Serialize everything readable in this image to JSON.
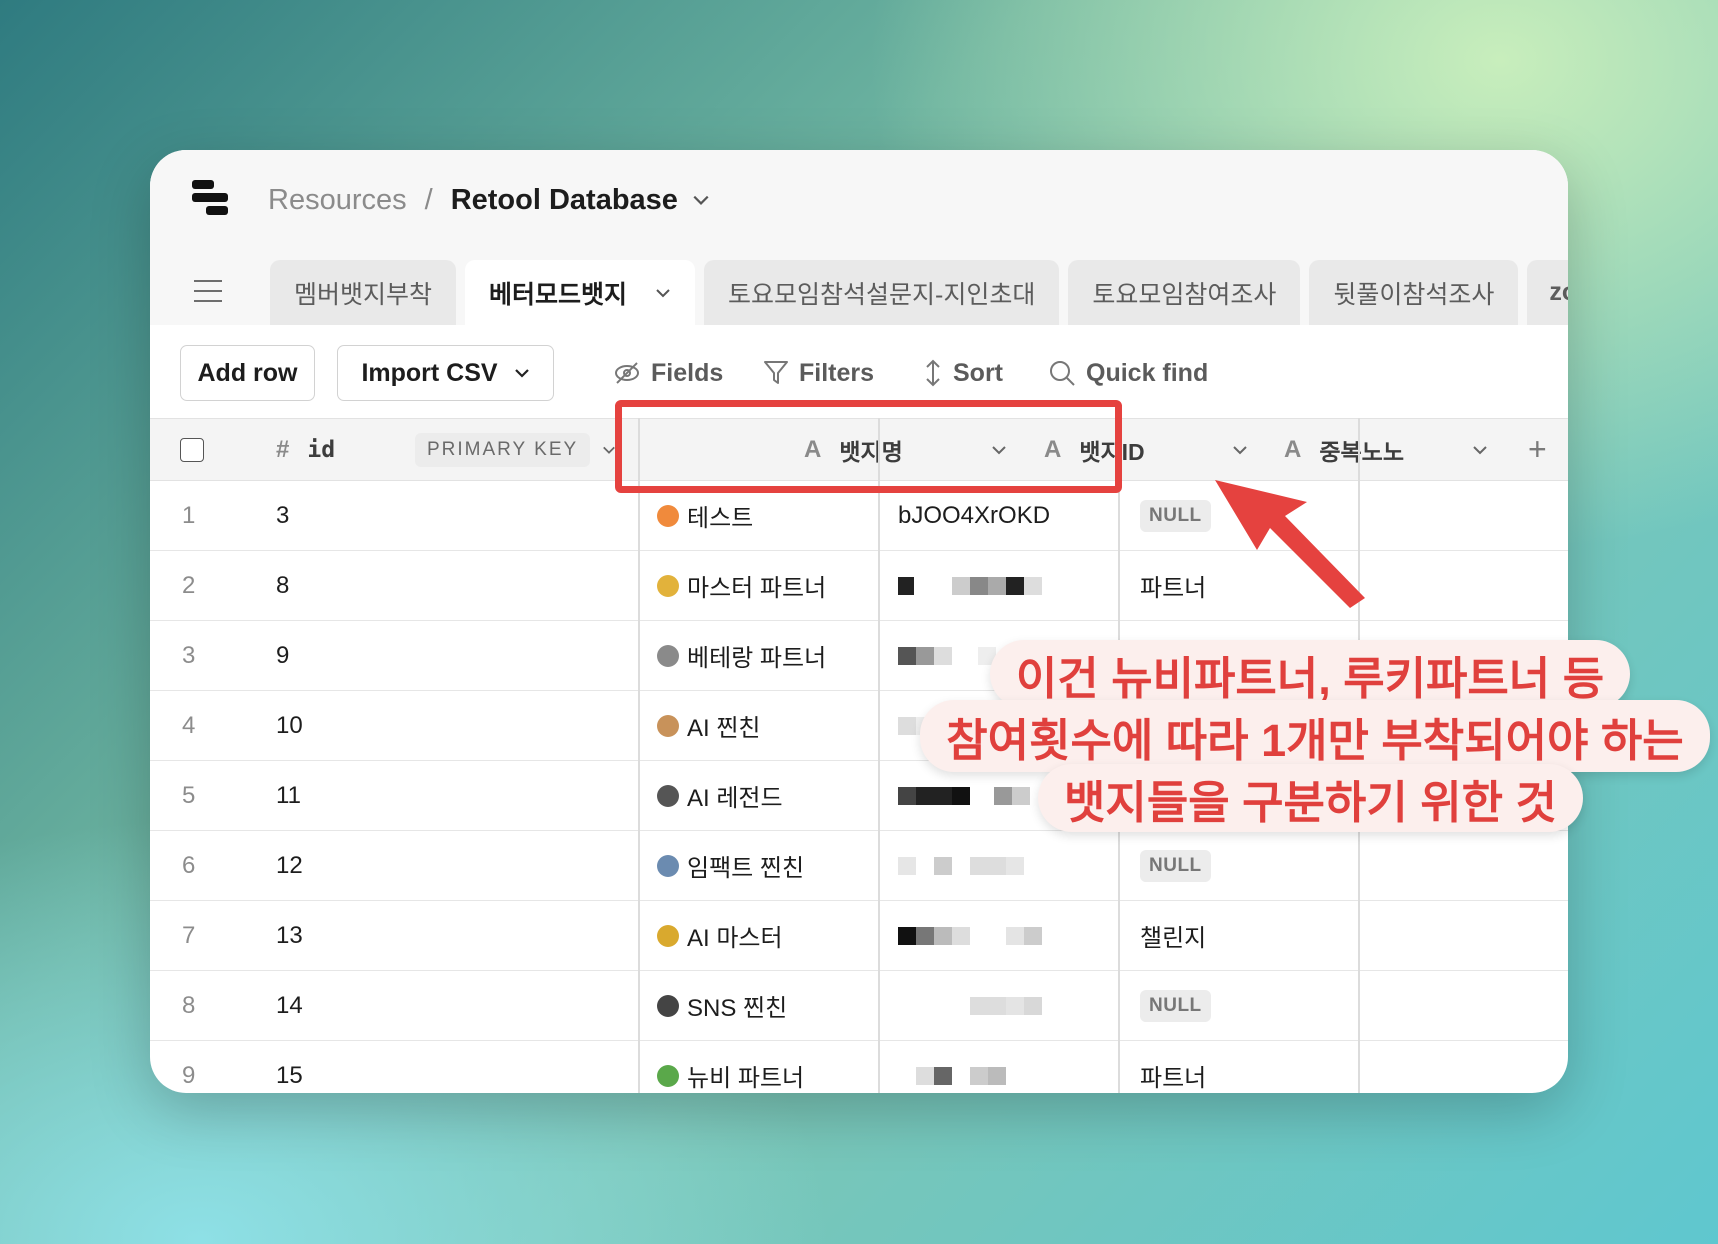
{
  "breadcrumb": {
    "parent": "Resources",
    "separator": "/",
    "current": "Retool Database"
  },
  "tabs": [
    {
      "label": "멤버뱃지부착"
    },
    {
      "label": "베터모드뱃지",
      "active": true
    },
    {
      "label": "토요모임참석설문지-지인초대"
    },
    {
      "label": "토요모임참여조사"
    },
    {
      "label": "뒷풀이참석조사"
    },
    {
      "label": "zo"
    }
  ],
  "toolbar": {
    "add_row": "Add row",
    "import_csv": "Import CSV",
    "fields": "Fields",
    "filters": "Filters",
    "sort": "Sort",
    "quick_find": "Quick find"
  },
  "columns": {
    "id": {
      "type_icon": "#",
      "label": "id",
      "badge": "PRIMARY KEY"
    },
    "badge_name": {
      "type_icon": "A",
      "label": "뱃지명"
    },
    "badge_id": {
      "type_icon": "A",
      "label": "뱃지ID"
    },
    "dup": {
      "type_icon": "A",
      "label": "중복노노"
    },
    "add": "+"
  },
  "rows": [
    {
      "n": "1",
      "id": "3",
      "emoji": "clown-face",
      "emoji_color": "#f08a3c",
      "name": "테스트",
      "badge_id": "bJOO4XrOKD",
      "dup": "NULL"
    },
    {
      "n": "2",
      "id": "8",
      "emoji": "medal",
      "emoji_color": "#e2b23b",
      "name": "마스터 파트너",
      "badge_id": "",
      "dup": "파트너"
    },
    {
      "n": "3",
      "id": "9",
      "emoji": "crossed-swords",
      "emoji_color": "#8a8a8a",
      "name": "베테랑 파트너",
      "badge_id": "",
      "dup": ""
    },
    {
      "n": "4",
      "id": "10",
      "emoji": "dog-face",
      "emoji_color": "#c8925a",
      "name": "AI 찐친",
      "badge_id": "",
      "dup": ""
    },
    {
      "n": "5",
      "id": "11",
      "emoji": "magic-wand",
      "emoji_color": "#555555",
      "name": "AI 레전드",
      "badge_id": "",
      "dup": ""
    },
    {
      "n": "6",
      "id": "12",
      "emoji": "microscope",
      "emoji_color": "#6b8bb0",
      "name": "임팩트 찐친",
      "badge_id": "",
      "dup": "NULL"
    },
    {
      "n": "7",
      "id": "13",
      "emoji": "medal",
      "emoji_color": "#d9a92e",
      "name": "AI 마스터",
      "badge_id": "",
      "dup": "챌린지"
    },
    {
      "n": "8",
      "id": "14",
      "emoji": "video-camera",
      "emoji_color": "#444444",
      "name": "SNS 찐친",
      "badge_id": "",
      "dup": "NULL"
    },
    {
      "n": "9",
      "id": "15",
      "emoji": "herb",
      "emoji_color": "#5aa84a",
      "name": "뉴비 파트너",
      "badge_id": "",
      "dup": "파트너"
    }
  ],
  "annotation": {
    "line1": "이건 뉴비파트너, 루키파트너 등",
    "line2": "참여횟수에 따라 1개만 부착되어야 하는",
    "line3": "뱃지들을 구분하기 위한 것",
    "color": "#e0403d"
  }
}
